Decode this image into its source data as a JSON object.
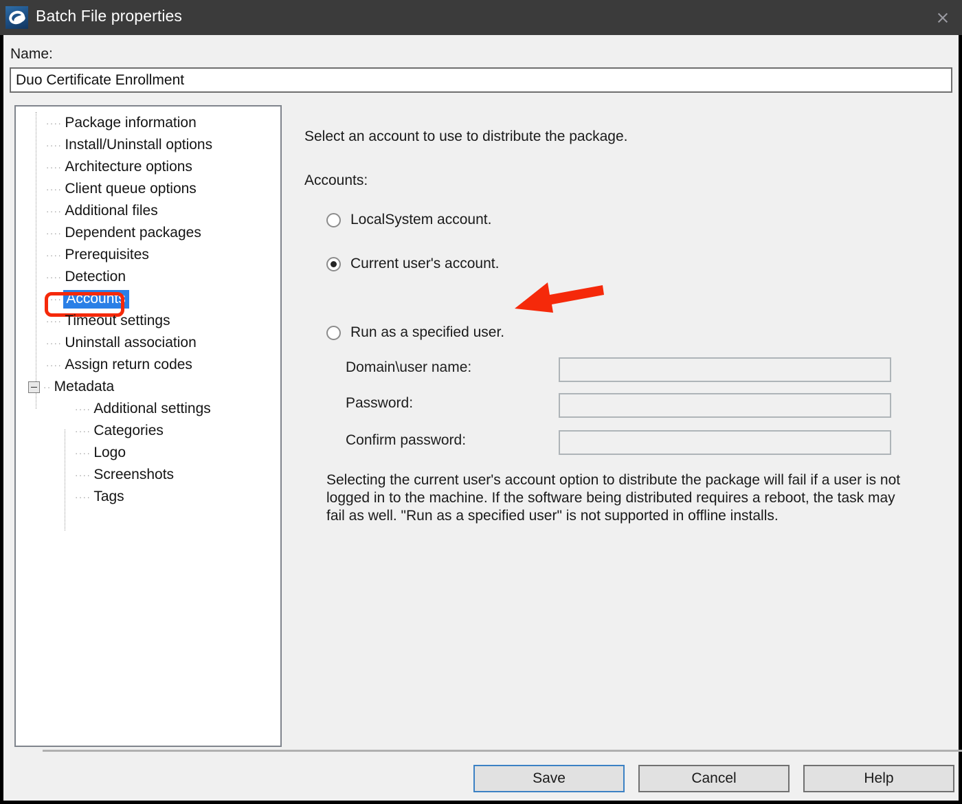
{
  "window": {
    "title": "Batch File properties",
    "icon": "package-icon",
    "close_icon": "close-icon"
  },
  "name_field": {
    "label": "Name:",
    "value": "Duo Certificate Enrollment",
    "placeholder": ""
  },
  "tree": {
    "items": [
      {
        "label": "Package information",
        "level": 1,
        "selected": false
      },
      {
        "label": "Install/Uninstall options",
        "level": 1,
        "selected": false
      },
      {
        "label": "Architecture options",
        "level": 1,
        "selected": false
      },
      {
        "label": "Client queue options",
        "level": 1,
        "selected": false
      },
      {
        "label": "Additional files",
        "level": 1,
        "selected": false
      },
      {
        "label": "Dependent packages",
        "level": 1,
        "selected": false
      },
      {
        "label": "Prerequisites",
        "level": 1,
        "selected": false
      },
      {
        "label": "Detection",
        "level": 1,
        "selected": false
      },
      {
        "label": "Accounts",
        "level": 1,
        "selected": true
      },
      {
        "label": "Timeout settings",
        "level": 1,
        "selected": false
      },
      {
        "label": "Uninstall association",
        "level": 1,
        "selected": false
      },
      {
        "label": "Assign return codes",
        "level": 1,
        "selected": false
      },
      {
        "label": "Metadata",
        "level": 1,
        "selected": false,
        "expanded": true
      },
      {
        "label": "Additional settings",
        "level": 2,
        "selected": false
      },
      {
        "label": "Categories",
        "level": 2,
        "selected": false
      },
      {
        "label": "Logo",
        "level": 2,
        "selected": false
      },
      {
        "label": "Screenshots",
        "level": 2,
        "selected": false
      },
      {
        "label": "Tags",
        "level": 2,
        "selected": false
      }
    ]
  },
  "pane": {
    "intro": "Select an account to use to distribute the package.",
    "accounts_label": "Accounts:",
    "options": [
      {
        "label": "LocalSystem account.",
        "checked": false
      },
      {
        "label": "Current user's account.",
        "checked": true
      },
      {
        "label": "Run as a specified user.",
        "checked": false
      }
    ],
    "fields": [
      {
        "label": "Domain\\user name:",
        "value": "",
        "placeholder": ""
      },
      {
        "label": "Password:",
        "value": "",
        "placeholder": ""
      },
      {
        "label": "Confirm password:",
        "value": "",
        "placeholder": ""
      }
    ],
    "note": "Selecting the current user's account option to distribute the package will fail if a user is not logged in to the machine. If the software being distributed requires a reboot, the task may fail as well.  \"Run as a specified user\" is not supported in offline installs."
  },
  "footer": {
    "save_label": "Save",
    "cancel_label": "Cancel",
    "help_label": "Help"
  },
  "annotations": {
    "highlight_color": "#f5290a",
    "arrow_color": "#f5290a",
    "selection_color": "#2a7fe6",
    "target": "Accounts",
    "arrow_points_to": "Current user's account."
  }
}
